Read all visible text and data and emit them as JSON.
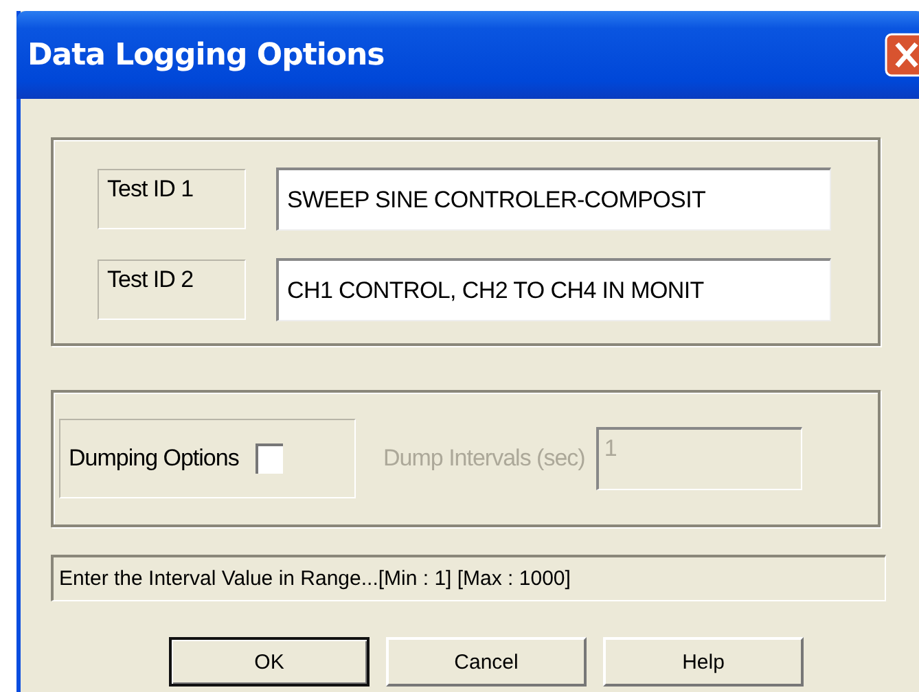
{
  "window": {
    "title": "Data Logging Options"
  },
  "test_ids": [
    {
      "label": "Test ID 1",
      "value": "SWEEP SINE CONTROLER-COMPOSIT"
    },
    {
      "label": "Test ID 2",
      "value": "CH1 CONTROL, CH2 TO CH4 IN MONIT"
    }
  ],
  "dumping": {
    "label": "Dumping Options",
    "checked": false,
    "interval_label": "Dump Intervals (sec)",
    "interval_value": "1",
    "interval_disabled": true
  },
  "status_bar": "Enter the Interval Value in Range...[Min : 1] [Max : 1000]",
  "buttons": [
    {
      "label": "OK",
      "default": true
    },
    {
      "label": "Cancel",
      "default": false
    },
    {
      "label": "Help",
      "default": false
    }
  ]
}
